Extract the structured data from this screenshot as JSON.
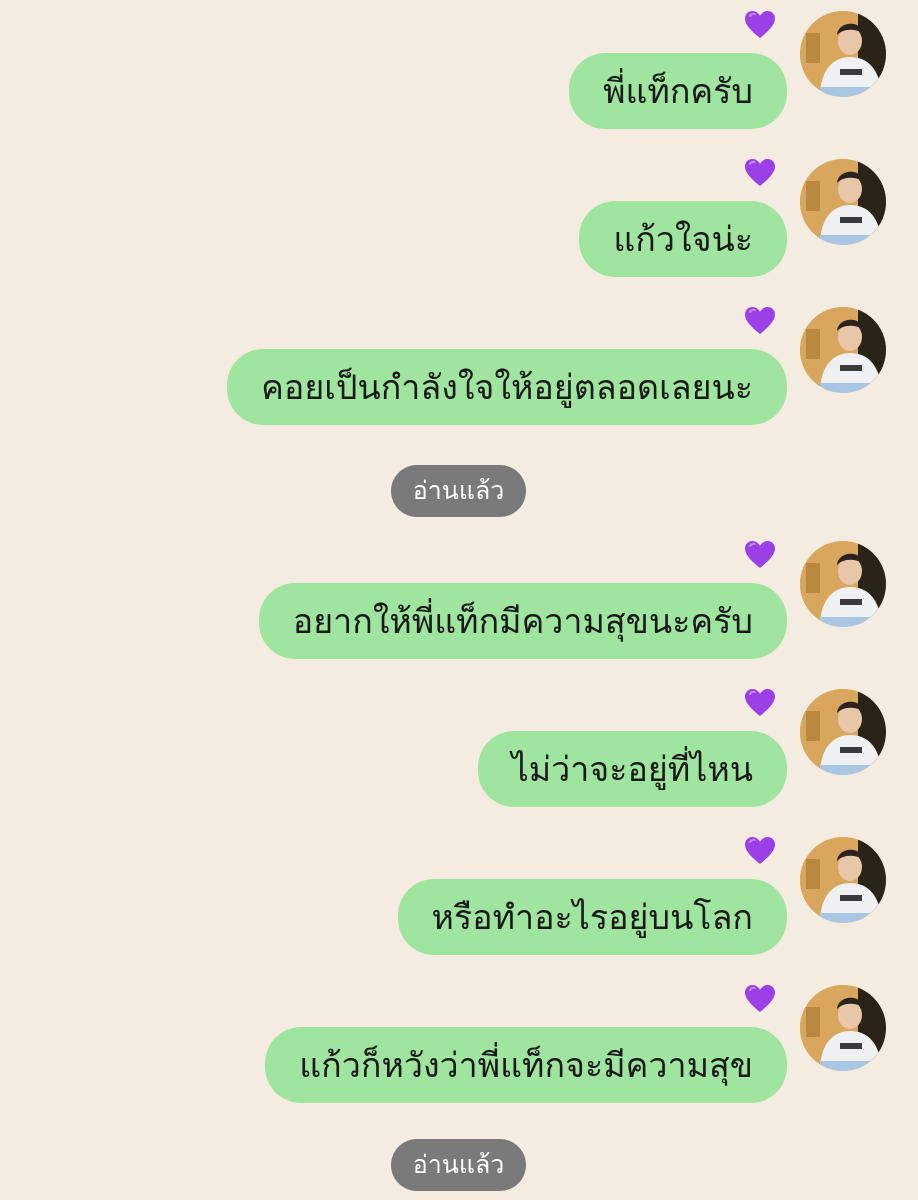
{
  "colors": {
    "background": "#f5ece1",
    "bubble": "#a0e59f",
    "heart": "#9b3fe6",
    "read_pill": "#7a7a7a"
  },
  "messages": [
    {
      "text": "พี่แท็กครับ",
      "reaction": "purple-heart"
    },
    {
      "text": "แก้วใจน่ะ",
      "reaction": "purple-heart"
    },
    {
      "text": "คอยเป็นกำลังใจให้อยู่ตลอดเลยนะ",
      "reaction": "purple-heart"
    },
    {
      "text": "อยากให้พี่แท็กมีความสุขนะครับ",
      "reaction": "purple-heart"
    },
    {
      "text": "ไม่ว่าจะอยู่ที่ไหน",
      "reaction": "purple-heart"
    },
    {
      "text": "หรือทำอะไรอยู่บนโลก",
      "reaction": "purple-heart"
    },
    {
      "text": "แก้วก็หวังว่าพี่แท็กจะมีความสุข",
      "reaction": "purple-heart"
    }
  ],
  "read_labels": [
    "อ่านแล้ว",
    "อ่านแล้ว"
  ]
}
